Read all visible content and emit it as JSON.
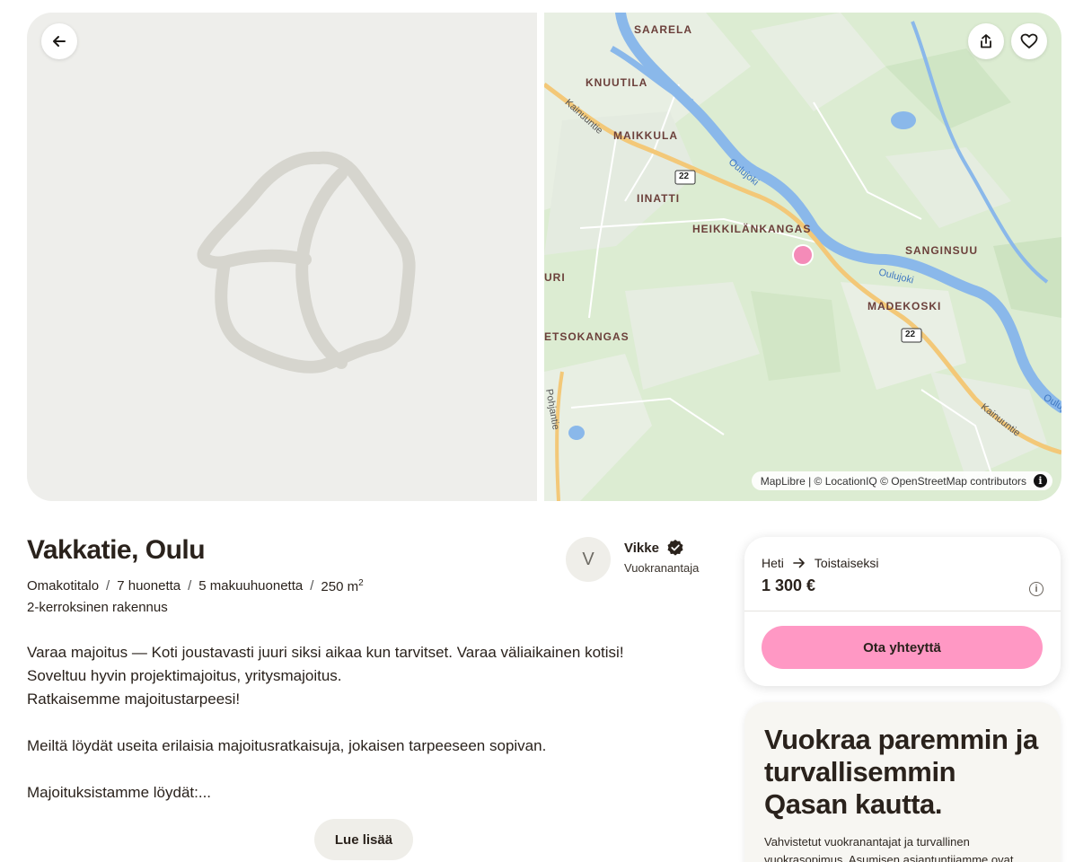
{
  "map": {
    "places": [
      "SAARELA",
      "KNUUTILA",
      "MAIKKULA",
      "IINATTI",
      "HEIKKILÄNKANGAS",
      "SANGINSUU",
      "MADEKOSKI",
      "ETSOKANGAS",
      "URI"
    ],
    "roads": [
      "Kainuuntie",
      "Pohjantie",
      "Kainuuntie"
    ],
    "rivers": [
      "Oulujoki",
      "Oulujoki",
      "Oulujoki"
    ],
    "route_shield": "22",
    "attribution": "MapLibre | © LocationIQ © OpenStreetMap contributors",
    "marker_color": "#f48bb8"
  },
  "listing": {
    "title": "Vakkatie, Oulu",
    "type": "Omakotitalo",
    "rooms": "7 huonetta",
    "bedrooms": "5 makuuhuonetta",
    "area": "250 m",
    "area_unit": "2",
    "building": "2-kerroksinen rakennus",
    "description": [
      "Varaa majoitus — Koti joustavasti juuri siksi aikaa kun tarvitset. Varaa väliaikainen kotisi!",
      "Soveltuu hyvin projektimajoitus, yritysmajoitus.",
      "Ratkaisemme majoitustarpeesi!",
      "Meiltä löydät useita erilaisia majoitusratkaisuja, jokaisen tarpeeseen sopivan.",
      "Majoituksistamme löydät:..."
    ],
    "read_more": "Lue lisää"
  },
  "landlord": {
    "initial": "V",
    "name": "Vikke",
    "role": "Vuokranantaja"
  },
  "price_card": {
    "from": "Heti",
    "to": "Toistaiseksi",
    "price": "1 300 €",
    "info": "i",
    "contact": "Ota yhteyttä"
  },
  "promo": {
    "heading": "Vuokraa paremmin ja turvallisemmin Qasan kautta.",
    "text": "Vahvistetut vuokranantajat ja turvallinen vuokrasopimus. Asumisen asiantuntijamme ovat"
  },
  "colors": {
    "accent": "#ff98c4",
    "text": "#2a221c",
    "photo_bg": "#eeeeeb"
  }
}
